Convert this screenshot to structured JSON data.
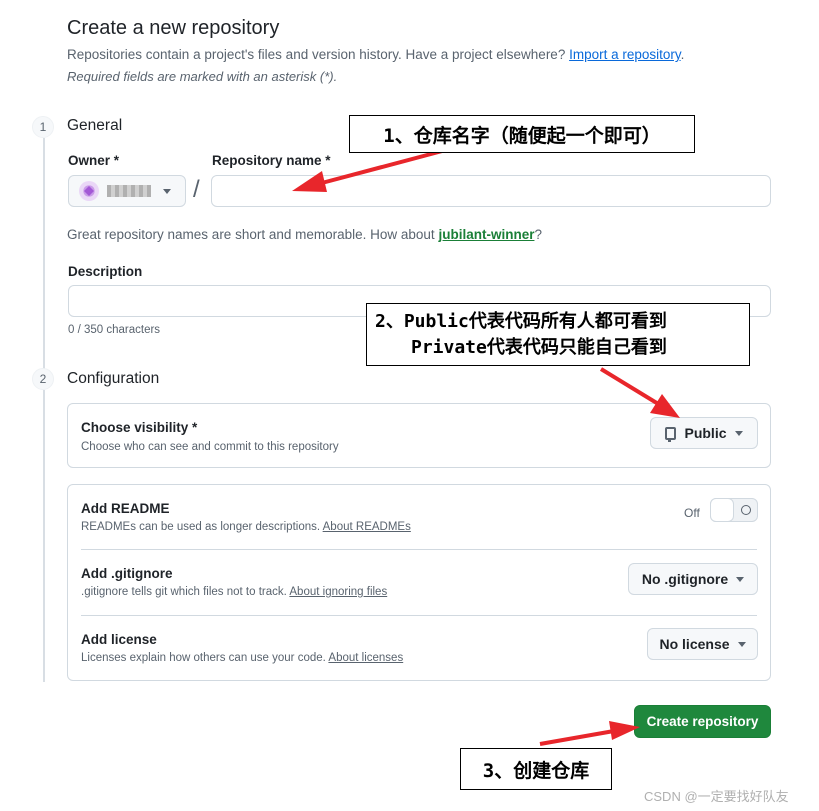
{
  "header": {
    "title": "Create a new repository",
    "intro_text": "Repositories contain a project's files and version history. Have a project elsewhere?",
    "import_link": "Import a repository",
    "intro_end": ".",
    "required_note": "Required fields are marked with an asterisk (*)."
  },
  "general": {
    "step": "1",
    "title": "General",
    "owner_label": "Owner *",
    "repo_name_label": "Repository name *",
    "slash": "/",
    "repo_name_value": "",
    "hint_prefix": "Great repository names are short and memorable. How about",
    "hint_suggestion": "jubilant-winner",
    "hint_suffix": "?",
    "description_label": "Description",
    "description_value": "",
    "char_counter": "0 / 350 characters"
  },
  "configuration": {
    "step": "2",
    "title": "Configuration",
    "visibility": {
      "title": "Choose visibility *",
      "desc": "Choose who can see and commit to this repository",
      "selected": "Public"
    },
    "readme": {
      "title": "Add README",
      "desc": "READMEs can be used as longer descriptions.",
      "link": "About READMEs",
      "toggle_state": "Off"
    },
    "gitignore": {
      "title": "Add .gitignore",
      "desc": ".gitignore tells git which files not to track.",
      "link": "About ignoring files",
      "selected": "No .gitignore"
    },
    "license": {
      "title": "Add license",
      "desc": "Licenses explain how others can use your code.",
      "link": "About licenses",
      "selected": "No license"
    }
  },
  "actions": {
    "create_label": "Create repository"
  },
  "annotations": {
    "note1": "1、仓库名字（随便起一个即可）",
    "note2_line1": "2、Public代表代码所有人都可看到",
    "note2_line2": "Private代表代码只能自己看到",
    "note3": "3、创建仓库",
    "arrow_color": "#e8262b"
  },
  "watermark": "CSDN @一定要找好队友",
  "colors": {
    "primary_button": "#1f883d",
    "link": "#0969da",
    "suggestion": "#1a7f37"
  }
}
